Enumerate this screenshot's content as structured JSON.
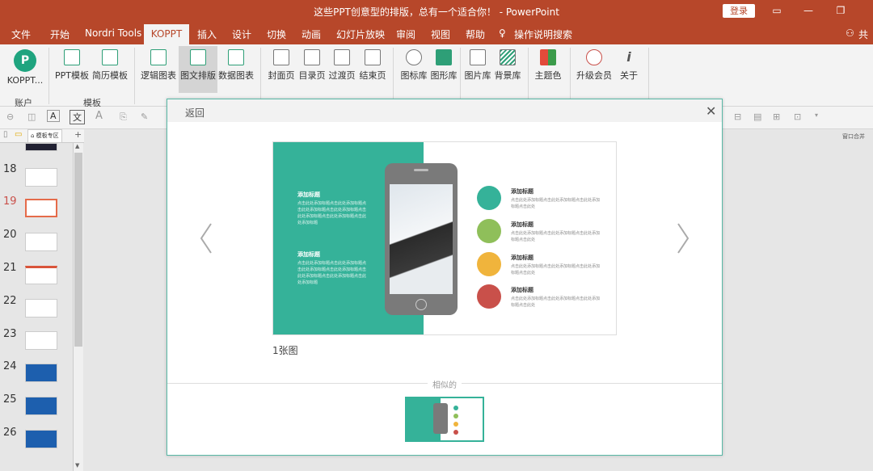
{
  "window": {
    "title": "这些PPT创意型的排版，总有一个适合你！ - PowerPoint",
    "login": "登录"
  },
  "menu": [
    "文件",
    "开始",
    "Nordri Tools",
    "KOPPT",
    "插入",
    "设计",
    "切换",
    "动画",
    "幻灯片放映",
    "审阅",
    "视图",
    "帮助",
    "操作说明搜索"
  ],
  "menu_share": "共",
  "ribbon": {
    "account": "KOPPT...",
    "groups": {
      "account": "账户",
      "template": "模板"
    },
    "buttons": [
      "PPT模板",
      "简历模板",
      "逻辑图表",
      "图文排版",
      "数据图表",
      "封面页",
      "目录页",
      "过渡页",
      "结束页",
      "图标库",
      "图形库",
      "图片库",
      "背景库",
      "主题色",
      "升级会员",
      "关于"
    ]
  },
  "sidebar": {
    "tab": "模板专区",
    "right_label": "窗口合并"
  },
  "slides": [
    {
      "n": "18"
    },
    {
      "n": "19"
    },
    {
      "n": "20"
    },
    {
      "n": "21"
    },
    {
      "n": "22"
    },
    {
      "n": "23"
    },
    {
      "n": "24"
    },
    {
      "n": "25"
    },
    {
      "n": "26"
    }
  ],
  "modal": {
    "back": "返回",
    "caption": "1张图",
    "similar": "相似的",
    "slide": {
      "left_title1": "添加标题",
      "left_text1": "点击此处添加标题点击此处添加标题点击此处添加标题点击此处添加标题点击此处添加标题点击此处添加标题点击此处添加标题",
      "left_title2": "添加标题",
      "left_text2": "点击此处添加标题点击此处添加标题点击此处添加标题点击此处添加标题点击此处添加标题点击此处添加标题点击此处添加标题",
      "items": [
        {
          "title": "添加标题",
          "text": "点击此处添加标题点击此处添加标题点击此处添加标题点击此处",
          "color": "#35b299"
        },
        {
          "title": "添加标题",
          "text": "点击此处添加标题点击此处添加标题点击此处添加标题点击此处",
          "color": "#8fbf5a"
        },
        {
          "title": "添加标题",
          "text": "点击此处添加标题点击此处添加标题点击此处添加标题点击此处",
          "color": "#f0b43c"
        },
        {
          "title": "添加标题",
          "text": "点击此处添加标题点击此处添加标题点击此处添加标题点击此处",
          "color": "#c9504a"
        }
      ]
    }
  }
}
